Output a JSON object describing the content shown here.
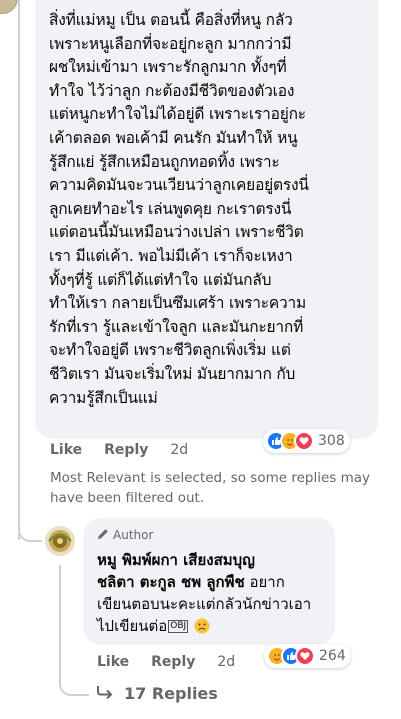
{
  "main_comment": {
    "lines": [
      "สิ่งที่แม่หมู เป็น ตอนนี้ คือสิ่งที่หนู กลัว",
      "เพราะหนูเลือกที่จะอยู่กะลูก มากกว่ามี",
      "ผชใหม่เข้ามา เพราะรักลูกมาก ทั้งๆที่",
      "ทำใจ ไว้ว่าลูก กะต้องมีชีวิตของตัวเอง",
      "แต่หนูกะทำใจไม่ได้อยู่ดี เพราะเราอยู่กะ",
      "เค้าตลอด พอเค้ามี คนรัก มันทำให้ หนู",
      "รู้สึกแย่ รู้สึกเหมือนถูกทอดทิ้ง เพราะ",
      "ความคิดมันจะวนเวียนว่าลูกเคยอยู่ตรงนี่",
      "ลูกเคยทำอะไร เล่นพูดคุย กะเราตรงนี่",
      "แต่ตอนนี้มันเหมือนว่างเปล่า เพราะชีวิต",
      "เรา มีแต่เค้า. พอไม่มีเค้า เราก็จะเหงา",
      "ทั้งๆที่รู้ แต่ก็ได้แต่ทำใจ แต่มันกลับ",
      "ทำให้เรา กลายเป็นซึมเศร้า เพราะความ",
      "รักที่เรา รู้และเข้าใจลูก และมันกะยากที่",
      "จะทำใจอยู่ดี เพราะชีวิตลูกเพิ่งเริ่ม แต่",
      "ชีวิตเรา มันจะเริ่มใหม่ มันยากมาก กับ",
      "ความรู้สึกเป็นแม่"
    ],
    "actions": {
      "like": "Like",
      "reply": "Reply",
      "time": "2d"
    },
    "reactions": {
      "icons": [
        "like-icon",
        "care-icon",
        "love-icon"
      ],
      "count": "308"
    }
  },
  "filter_note": "Most Relevant is selected, so some replies may have been filtered out.",
  "reply": {
    "badge": "Author",
    "author": "หมู พิมพ์ผกา เสียงสมบุญ",
    "mention": "ชลิตา ตะกูล ชพ ลูกพืช",
    "line1_rest": "อยาก",
    "line2": "เขียนตอบนะคะแต่กลัวนักข่าวเอา",
    "line3": "ไปเขียนต่อ",
    "obj_glyph": "OBJ",
    "actions": {
      "like": "Like",
      "reply": "Reply",
      "time": "2d"
    },
    "reactions": {
      "icons": [
        "care-icon",
        "like-icon",
        "love-icon"
      ],
      "count": "264"
    }
  },
  "view_replies": "17 Replies",
  "colors": {
    "bubble": "#f0f2f5",
    "secondary_text": "#65676b",
    "like_blue": "#1877f2",
    "love_red": "#f33e58",
    "care_yellow": "#f7b125",
    "thread_line": "#ced0d4"
  }
}
